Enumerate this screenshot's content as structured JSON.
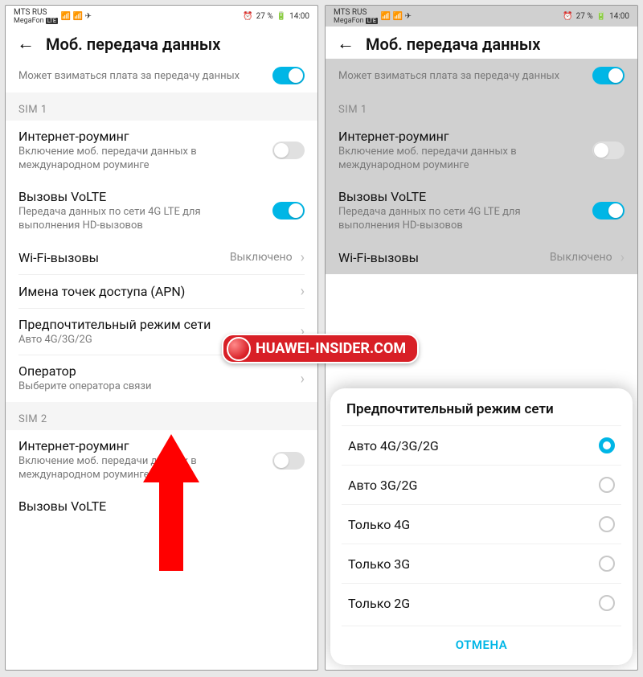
{
  "statusbar": {
    "carrier1": "MTS RUS",
    "carrier2": "MegaFon",
    "battery": "27 %",
    "time": "14:00"
  },
  "header": {
    "title": "Моб. передача данных"
  },
  "top_toggle": {
    "sub": "Может взиматься плата за передачу данных"
  },
  "sim1": {
    "header": "SIM 1",
    "roaming": {
      "label": "Интернет-роуминг",
      "sub": "Включение моб. передачи данных в международном роуминге"
    },
    "volte": {
      "label": "Вызовы VoLTE",
      "sub": "Передача данных по сети 4G LTE для выполнения HD-вызовов"
    },
    "wifi_calls": {
      "label": "Wi-Fi-вызовы",
      "value": "Выключено"
    },
    "apn": {
      "label": "Имена точек доступа (APN)"
    },
    "network_mode": {
      "label": "Предпочтительный режим сети",
      "sub": "Авто 4G/3G/2G"
    },
    "operator": {
      "label": "Оператор",
      "sub": "Выберите оператора связи"
    }
  },
  "sim2": {
    "header": "SIM 2",
    "roaming": {
      "label": "Интернет-роуминг",
      "sub": "Включение моб. передачи данных в международном роуминге"
    },
    "volte": {
      "label": "Вызовы VoLTE"
    }
  },
  "right_wifi_value": "Выключено",
  "sheet": {
    "title": "Предпочтительный режим сети",
    "options": [
      "Авто 4G/3G/2G",
      "Авто 3G/2G",
      "Только 4G",
      "Только 3G",
      "Только 2G"
    ],
    "selected_index": 0,
    "cancel": "ОТМЕНА"
  },
  "watermark": "HUAWEI-INSIDER.COM"
}
